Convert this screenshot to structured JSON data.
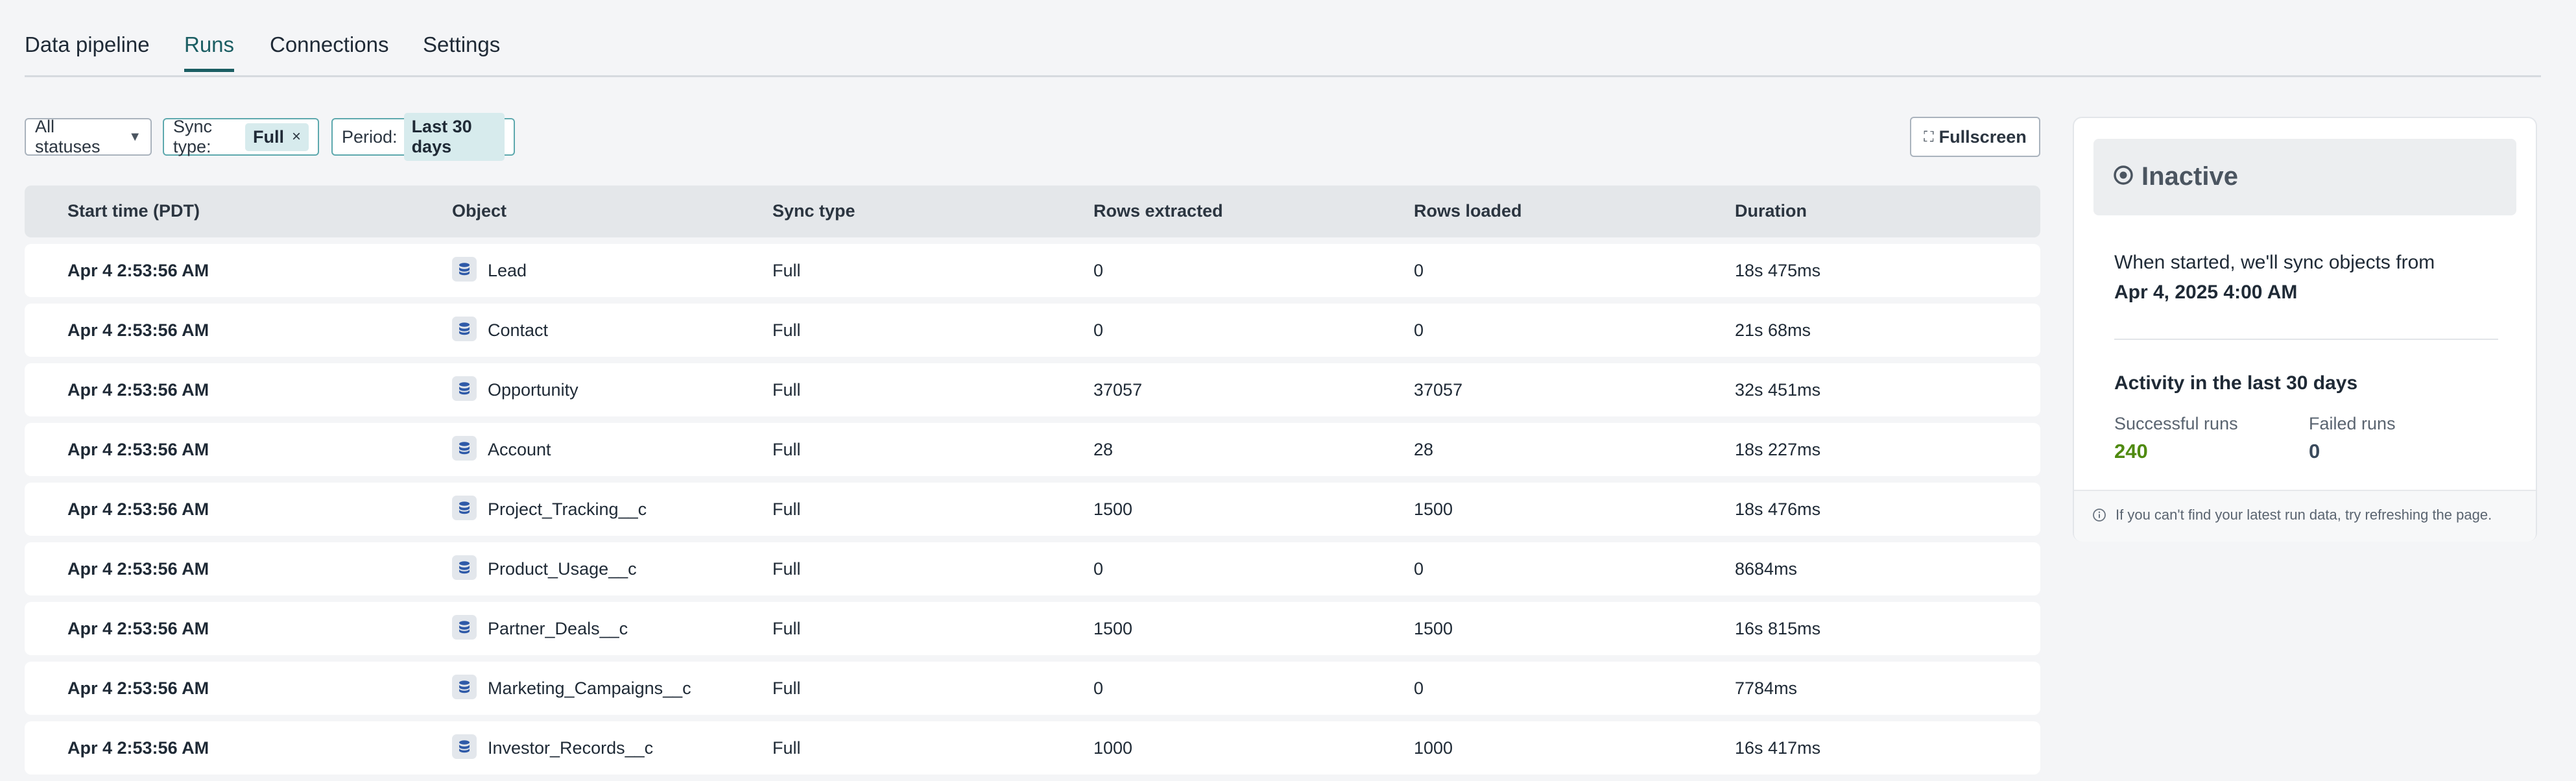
{
  "tabs": [
    {
      "label": "Data pipeline"
    },
    {
      "label": "Runs"
    },
    {
      "label": "Connections"
    },
    {
      "label": "Settings"
    }
  ],
  "filters": {
    "status": {
      "value": "All statuses"
    },
    "sync_type": {
      "label": "Sync type:",
      "value": "Full"
    },
    "period": {
      "label": "Period:",
      "value": "Last 30 days"
    }
  },
  "fullscreen_label": "Fullscreen",
  "table": {
    "columns": [
      "Start time (PDT)",
      "Object",
      "Sync type",
      "Rows extracted",
      "Rows loaded",
      "Duration"
    ],
    "rows": [
      {
        "start": "Apr 4 2:53:56 AM",
        "object": "Lead",
        "sync": "Full",
        "extracted": "0",
        "loaded": "0",
        "duration": "18s 475ms"
      },
      {
        "start": "Apr 4 2:53:56 AM",
        "object": "Contact",
        "sync": "Full",
        "extracted": "0",
        "loaded": "0",
        "duration": "21s 68ms"
      },
      {
        "start": "Apr 4 2:53:56 AM",
        "object": "Opportunity",
        "sync": "Full",
        "extracted": "37057",
        "loaded": "37057",
        "duration": "32s 451ms"
      },
      {
        "start": "Apr 4 2:53:56 AM",
        "object": "Account",
        "sync": "Full",
        "extracted": "28",
        "loaded": "28",
        "duration": "18s 227ms"
      },
      {
        "start": "Apr 4 2:53:56 AM",
        "object": "Project_Tracking__c",
        "sync": "Full",
        "extracted": "1500",
        "loaded": "1500",
        "duration": "18s 476ms"
      },
      {
        "start": "Apr 4 2:53:56 AM",
        "object": "Product_Usage__c",
        "sync": "Full",
        "extracted": "0",
        "loaded": "0",
        "duration": "8684ms"
      },
      {
        "start": "Apr 4 2:53:56 AM",
        "object": "Partner_Deals__c",
        "sync": "Full",
        "extracted": "1500",
        "loaded": "1500",
        "duration": "16s 815ms"
      },
      {
        "start": "Apr 4 2:53:56 AM",
        "object": "Marketing_Campaigns__c",
        "sync": "Full",
        "extracted": "0",
        "loaded": "0",
        "duration": "7784ms"
      },
      {
        "start": "Apr 4 2:53:56 AM",
        "object": "Investor_Records__c",
        "sync": "Full",
        "extracted": "1000",
        "loaded": "1000",
        "duration": "16s 417ms"
      }
    ]
  },
  "panel": {
    "status": "Inactive",
    "sync_line1": "When started, we'll sync objects from",
    "sync_line2": "Apr 4, 2025 4:00 AM",
    "activity_heading": "Activity in the last 30 days",
    "successful_label": "Successful runs",
    "successful_value": "240",
    "failed_label": "Failed runs",
    "failed_value": "0",
    "footer_note": "If you can't find your latest run data, try refreshing the page."
  },
  "colors": {
    "accent": "#1b5e63",
    "success": "#4f8a10",
    "object_icon": "#2f5aa8"
  }
}
